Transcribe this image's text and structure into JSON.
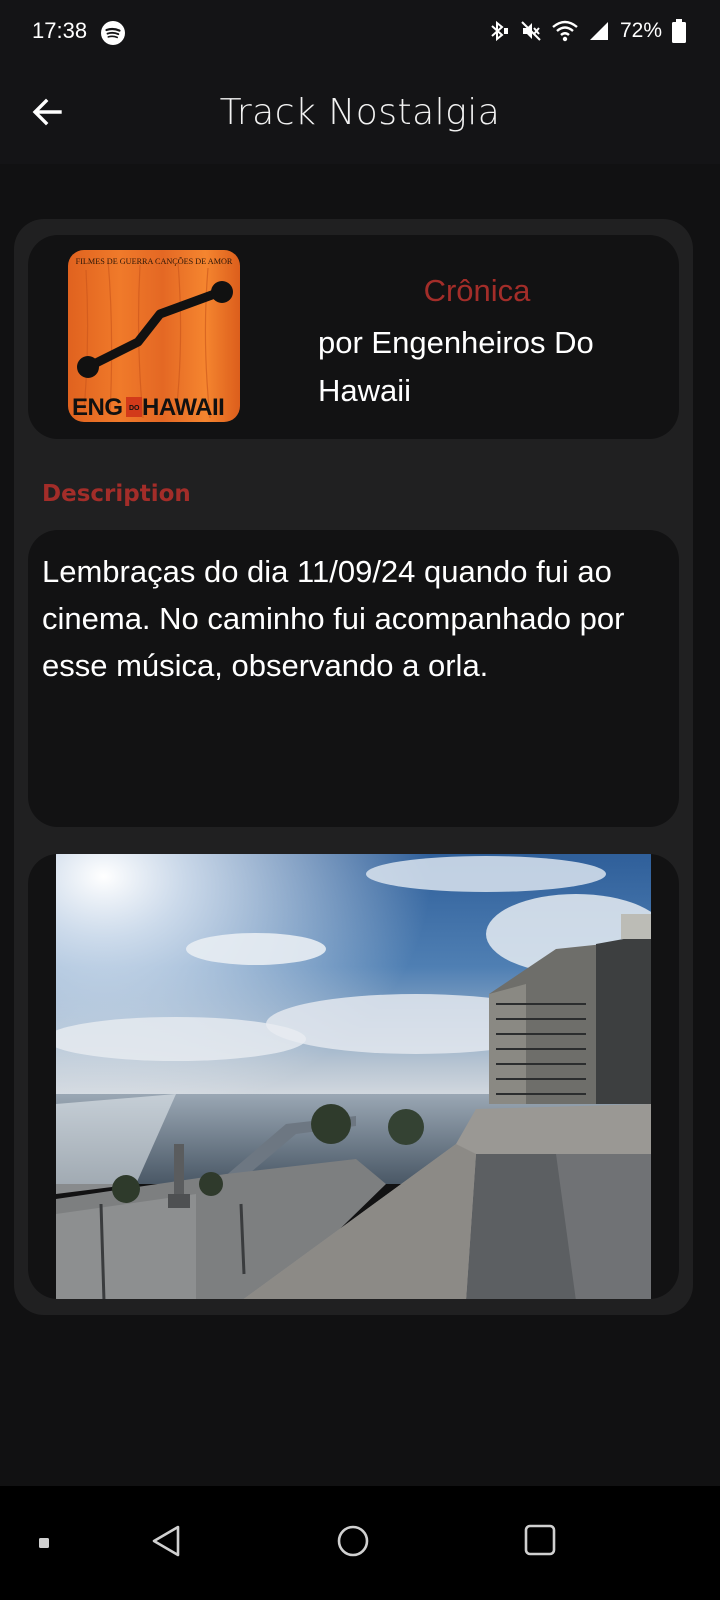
{
  "status_bar": {
    "time": "17:38",
    "battery": "72%",
    "icons": [
      "spotify-icon",
      "bluetooth-icon",
      "mute-icon",
      "wifi-icon",
      "signal-icon",
      "battery-icon"
    ]
  },
  "app_bar": {
    "title": "Track Nostalgia",
    "back_icon": "arrow-left-icon"
  },
  "track": {
    "name": "Crônica",
    "artist": "por Engenheiros Do Hawaii",
    "album_art": {
      "top_text": "FILMES DE GUERRA CANÇÕES DE AMOR",
      "bottom_text": "ENG HAWAII",
      "bottom_text_inner": "DO"
    }
  },
  "description": {
    "label": "Description",
    "text": "Lembraças do dia 11/09/24 quando fui ao cinema. No caminho fui acompanhado por esse música, observando a orla."
  },
  "colors": {
    "accent": "#a32d29",
    "background": "#111112",
    "card": "#202021",
    "inner_card": "#121213"
  },
  "nav_bar": {
    "icons": [
      "recents-dot-icon",
      "back-triangle-icon",
      "home-circle-icon",
      "overview-square-icon"
    ]
  }
}
